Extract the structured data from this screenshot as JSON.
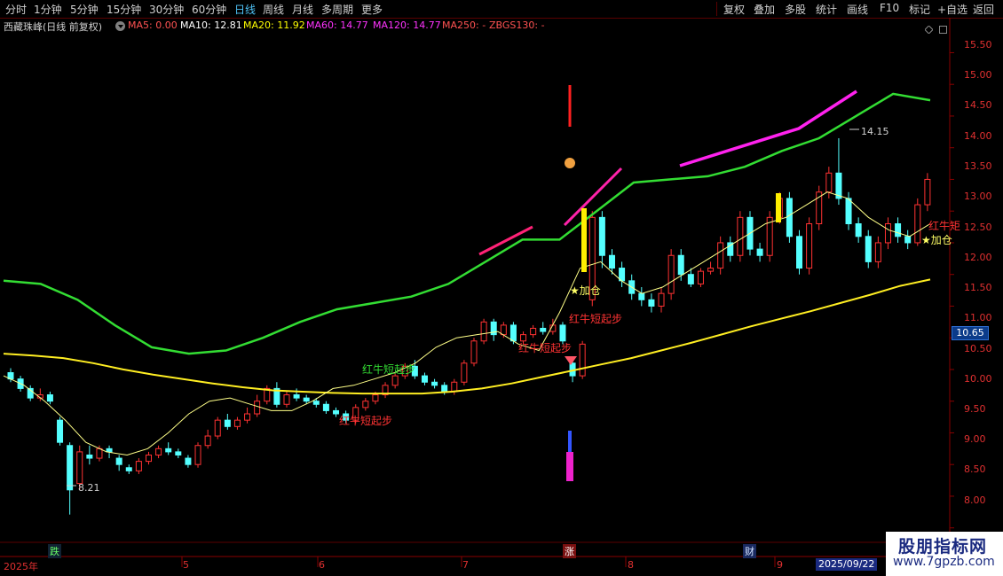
{
  "toolbar": {
    "periods": [
      "分时",
      "1分钟",
      "5分钟",
      "15分钟",
      "30分钟",
      "60分钟",
      "日线",
      "周线",
      "月线",
      "多周期",
      "更多"
    ],
    "active_period": "日线",
    "actions": [
      "复权",
      "叠加",
      "多股",
      "统计",
      "画线",
      "F10",
      "标记",
      "+自选",
      "返回"
    ]
  },
  "legend": {
    "title": "西藏珠峰(日线 前复权)",
    "ma5": "MA5: 0.00",
    "ma10": "MA10: 12.81",
    "ma20": "MA20: 11.92",
    "ma60": "MA60: 14.77",
    "ma120": "MA120: 14.77",
    "ma250": "MA250: -",
    "zbgs": "ZBGS130: -",
    "colors": {
      "ma5": "#ff5252",
      "ma10": "#ffffff",
      "ma20": "#ffff00",
      "ma60": "#ff33ff",
      "ma120": "#ff33ff",
      "ma250": "#ff5252",
      "zbgs": "#ff5252"
    }
  },
  "price_axis": [
    "15.50",
    "15.00",
    "14.50",
    "14.00",
    "13.50",
    "13.00",
    "12.50",
    "12.00",
    "11.50",
    "11.00",
    "10.65",
    "10.50",
    "10.00",
    "9.50",
    "9.00",
    "8.50",
    "8.00"
  ],
  "current_price": "10.65",
  "time_axis": {
    "year_label": "2025年",
    "months": [
      "5",
      "6",
      "7",
      "8",
      "9"
    ],
    "cursor_date": "2025/09/22"
  },
  "markers": {
    "down": "跌",
    "up": "涨",
    "finance": "财"
  },
  "annotations": {
    "low": "8.21",
    "high": "14.15",
    "signal_short": "红牛短起步",
    "signal_short_green": "红牛短起步",
    "add_position": "加仓",
    "right_label": "红牛矩"
  },
  "watermark": {
    "title": "股朋指标网",
    "url": "www.7gpzb.com"
  },
  "chart_data": {
    "type": "candlestick",
    "title": "西藏珠峰(日线 前复权)",
    "ylim": [
      7.8,
      15.8
    ],
    "x_ticks": [
      "2025年",
      "5",
      "6",
      "7",
      "8",
      "9"
    ],
    "candles": [
      [
        10.45,
        10.35,
        10.52,
        10.3
      ],
      [
        10.35,
        10.2,
        10.4,
        10.15
      ],
      [
        10.2,
        10.05,
        10.25,
        10.0
      ],
      [
        10.05,
        10.1,
        10.2,
        10.0
      ],
      [
        10.1,
        10.0,
        10.15,
        9.95
      ],
      [
        9.7,
        9.35,
        9.75,
        9.3
      ],
      [
        9.3,
        8.6,
        9.35,
        8.21
      ],
      [
        8.7,
        9.2,
        9.3,
        8.6
      ],
      [
        9.15,
        9.1,
        9.3,
        9.0
      ],
      [
        9.1,
        9.25,
        9.3,
        9.05
      ],
      [
        9.25,
        9.2,
        9.3,
        9.1
      ],
      [
        9.1,
        9.0,
        9.15,
        8.9
      ],
      [
        8.95,
        8.9,
        9.0,
        8.85
      ],
      [
        8.9,
        9.05,
        9.1,
        8.85
      ],
      [
        9.05,
        9.15,
        9.2,
        9.0
      ],
      [
        9.15,
        9.25,
        9.3,
        9.1
      ],
      [
        9.25,
        9.2,
        9.35,
        9.15
      ],
      [
        9.2,
        9.15,
        9.25,
        9.1
      ],
      [
        9.1,
        9.0,
        9.15,
        8.95
      ],
      [
        9.0,
        9.3,
        9.35,
        8.95
      ],
      [
        9.3,
        9.45,
        9.55,
        9.25
      ],
      [
        9.45,
        9.7,
        9.75,
        9.4
      ],
      [
        9.7,
        9.6,
        9.8,
        9.55
      ],
      [
        9.6,
        9.7,
        9.75,
        9.55
      ],
      [
        9.7,
        9.8,
        9.9,
        9.65
      ],
      [
        9.8,
        10.0,
        10.1,
        9.75
      ],
      [
        10.0,
        10.2,
        10.25,
        9.95
      ],
      [
        10.2,
        9.95,
        10.3,
        9.9
      ],
      [
        9.95,
        10.1,
        10.15,
        9.9
      ],
      [
        10.1,
        10.05,
        10.2,
        10.0
      ],
      [
        10.05,
        10.0,
        10.1,
        9.95
      ],
      [
        10.0,
        9.95,
        10.05,
        9.9
      ],
      [
        9.95,
        9.85,
        10.0,
        9.8
      ],
      [
        9.85,
        9.8,
        9.9,
        9.75
      ],
      [
        9.8,
        9.7,
        9.85,
        9.65
      ],
      [
        9.7,
        9.9,
        9.95,
        9.65
      ],
      [
        9.9,
        10.0,
        10.05,
        9.85
      ],
      [
        10.0,
        10.1,
        10.15,
        9.95
      ],
      [
        10.1,
        10.25,
        10.3,
        10.05
      ],
      [
        10.25,
        10.4,
        10.45,
        10.2
      ],
      [
        10.4,
        10.55,
        10.6,
        10.35
      ],
      [
        10.55,
        10.4,
        10.65,
        10.35
      ],
      [
        10.4,
        10.3,
        10.45,
        10.25
      ],
      [
        10.3,
        10.25,
        10.35,
        10.2
      ],
      [
        10.25,
        10.15,
        10.3,
        10.1
      ],
      [
        10.15,
        10.3,
        10.35,
        10.1
      ],
      [
        10.3,
        10.6,
        10.65,
        10.25
      ],
      [
        10.6,
        10.95,
        11.0,
        10.55
      ],
      [
        10.95,
        11.25,
        11.3,
        10.9
      ],
      [
        11.25,
        11.05,
        11.3,
        10.95
      ],
      [
        11.05,
        11.2,
        11.25,
        11.0
      ],
      [
        11.2,
        10.95,
        11.25,
        10.9
      ],
      [
        10.95,
        11.05,
        11.1,
        10.9
      ],
      [
        11.05,
        11.15,
        11.2,
        11.0
      ],
      [
        11.15,
        11.1,
        11.25,
        11.05
      ],
      [
        11.1,
        11.2,
        11.3,
        11.05
      ],
      [
        11.2,
        10.95,
        11.25,
        10.9
      ],
      [
        10.6,
        10.4,
        10.65,
        10.3
      ],
      [
        10.4,
        10.9,
        10.95,
        10.35
      ],
      [
        11.6,
        12.9,
        13.0,
        11.5
      ],
      [
        12.9,
        12.3,
        13.0,
        12.1
      ],
      [
        12.3,
        12.1,
        12.4,
        12.0
      ],
      [
        12.1,
        11.9,
        12.2,
        11.8
      ],
      [
        11.9,
        11.7,
        12.0,
        11.6
      ],
      [
        11.7,
        11.6,
        11.8,
        11.5
      ],
      [
        11.6,
        11.5,
        11.7,
        11.4
      ],
      [
        11.5,
        11.7,
        11.8,
        11.4
      ],
      [
        11.7,
        12.3,
        12.4,
        11.6
      ],
      [
        12.3,
        12.0,
        12.4,
        11.9
      ],
      [
        12.0,
        11.85,
        12.1,
        11.8
      ],
      [
        11.85,
        12.05,
        12.1,
        11.8
      ],
      [
        12.05,
        12.1,
        12.2,
        12.0
      ],
      [
        12.1,
        12.5,
        12.6,
        12.0
      ],
      [
        12.5,
        12.3,
        12.6,
        12.2
      ],
      [
        12.3,
        12.9,
        13.0,
        12.2
      ],
      [
        12.9,
        12.4,
        13.0,
        12.3
      ],
      [
        12.4,
        12.3,
        12.5,
        12.2
      ],
      [
        12.3,
        12.9,
        13.0,
        12.2
      ],
      [
        12.9,
        13.2,
        13.3,
        12.8
      ],
      [
        13.2,
        12.6,
        13.3,
        12.5
      ],
      [
        12.6,
        12.1,
        12.7,
        12.0
      ],
      [
        12.1,
        12.8,
        12.9,
        12.0
      ],
      [
        12.8,
        13.3,
        13.4,
        12.7
      ],
      [
        13.3,
        13.6,
        13.7,
        13.2
      ],
      [
        13.6,
        13.2,
        14.15,
        13.1
      ],
      [
        13.2,
        12.8,
        13.3,
        12.7
      ],
      [
        12.8,
        12.6,
        12.9,
        12.5
      ],
      [
        12.6,
        12.2,
        12.7,
        12.1
      ],
      [
        12.2,
        12.5,
        12.6,
        12.1
      ],
      [
        12.5,
        12.8,
        12.9,
        12.4
      ],
      [
        12.8,
        12.6,
        12.9,
        12.5
      ],
      [
        12.6,
        12.5,
        12.7,
        12.4
      ],
      [
        12.5,
        13.1,
        13.2,
        12.45
      ],
      [
        13.1,
        13.5,
        13.6,
        13.0
      ]
    ],
    "ma_yellow": [
      10.75,
      10.72,
      10.68,
      10.6,
      10.5,
      10.42,
      10.35,
      10.28,
      10.22,
      10.17,
      10.15,
      10.13,
      10.12,
      10.12,
      10.12,
      10.15,
      10.2,
      10.28,
      10.38,
      10.48,
      10.58,
      10.68,
      10.8,
      10.92,
      11.05,
      11.18,
      11.3,
      11.42,
      11.55,
      11.68,
      11.82,
      11.92
    ],
    "ma_green": [
      11.9,
      11.85,
      11.6,
      11.2,
      10.85,
      10.75,
      10.8,
      11.0,
      11.25,
      11.45,
      11.55,
      11.65,
      11.85,
      12.2,
      12.55,
      12.55,
      13.0,
      13.45,
      13.5,
      13.55,
      13.7,
      13.95,
      14.15,
      14.5,
      14.85,
      14.75
    ],
    "ma_thin": [
      10.4,
      10.25,
      10.0,
      9.7,
      9.35,
      9.2,
      9.15,
      9.25,
      9.5,
      9.8,
      10.0,
      10.05,
      9.95,
      9.85,
      9.85,
      10.0,
      10.2,
      10.25,
      10.35,
      10.45,
      10.6,
      10.85,
      11.0,
      11.05,
      11.1,
      10.9,
      10.8,
      11.4,
      12.1,
      12.2,
      11.9,
      11.7,
      11.8,
      12.0,
      12.2,
      12.4,
      12.6,
      12.8,
      12.9,
      13.1,
      13.3,
      13.2,
      12.9,
      12.7,
      12.6,
      12.8
    ]
  }
}
